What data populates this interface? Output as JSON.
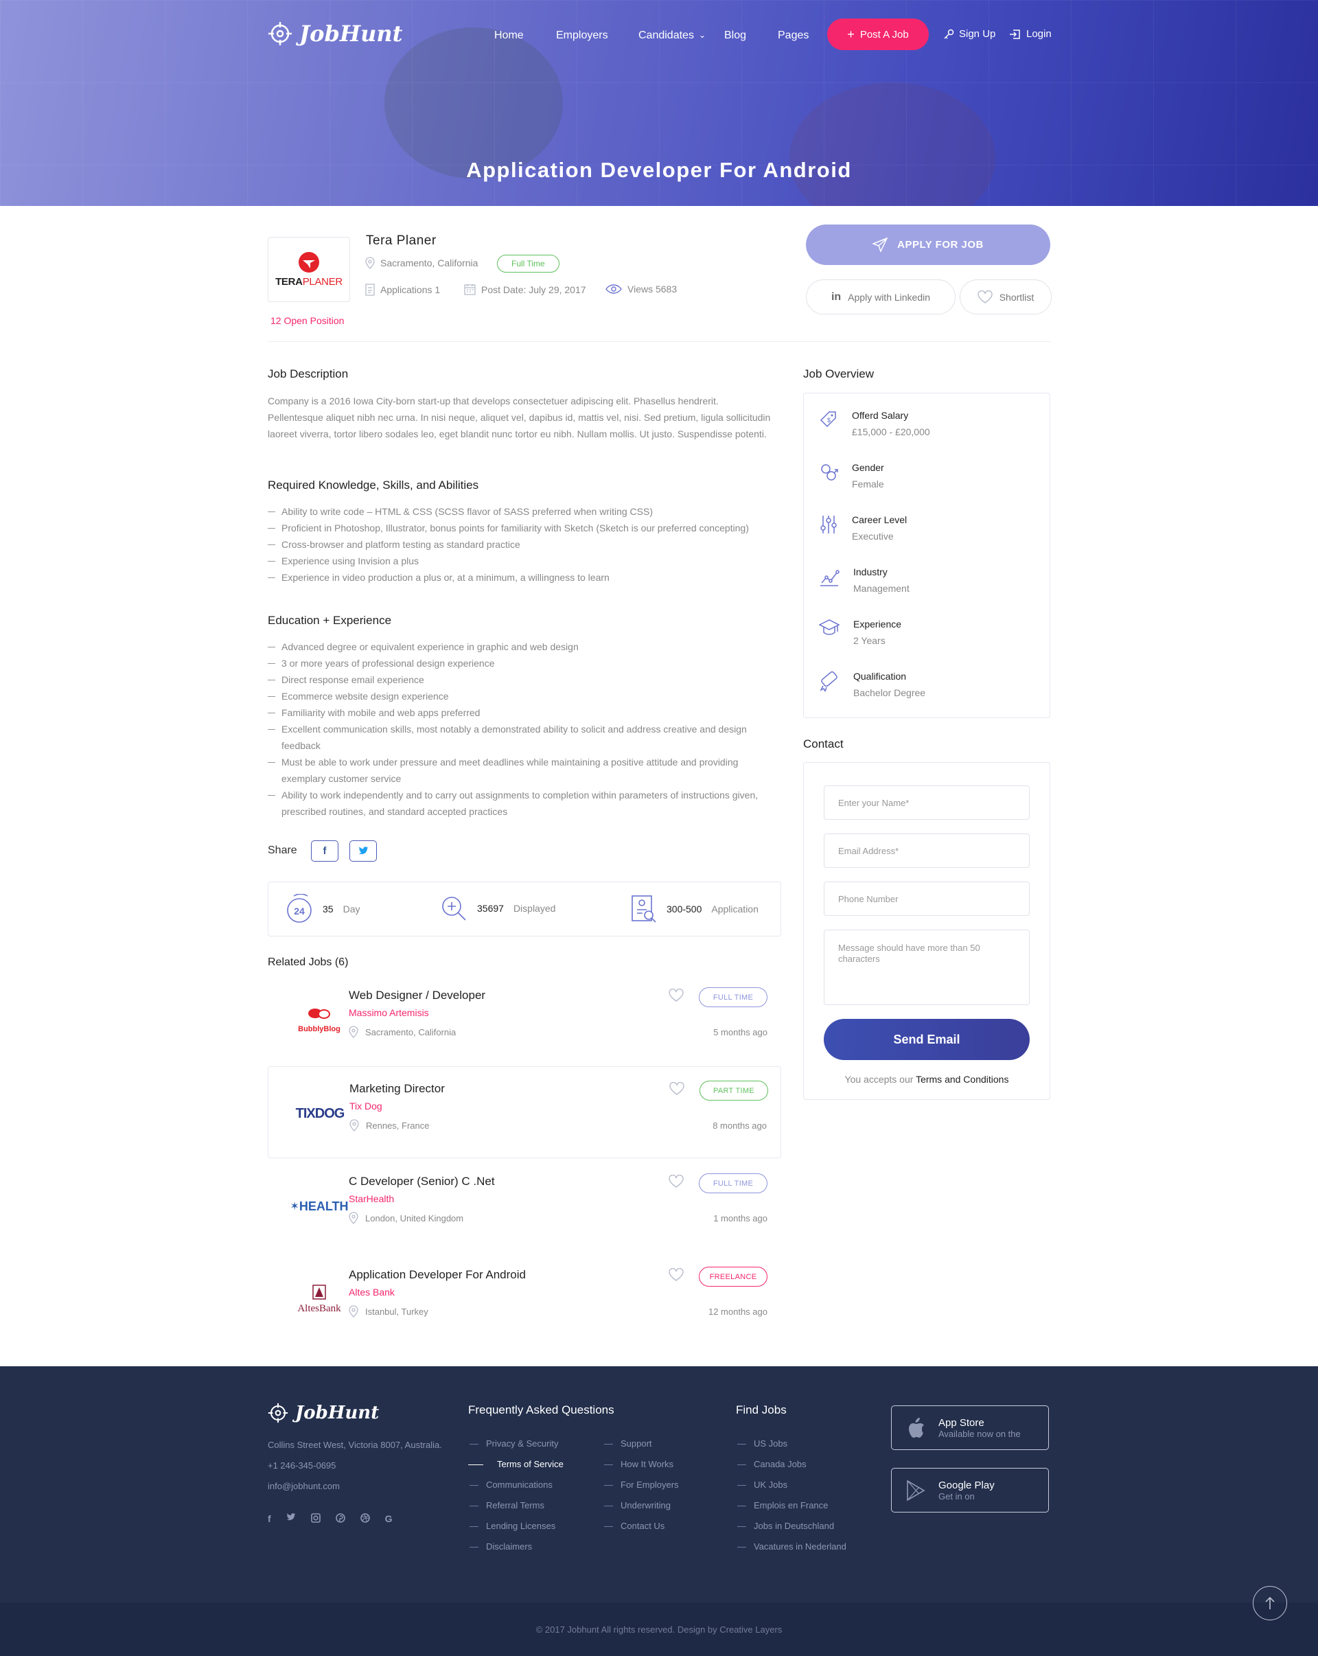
{
  "brand": {
    "name": "JobHunt"
  },
  "nav": {
    "items": [
      "Home",
      "Employers",
      "Candidates",
      "Blog",
      "Pages"
    ],
    "post_job": "Post A Job",
    "signup": "Sign Up",
    "login": "Login"
  },
  "hero": {
    "title": "Application Developer For Android"
  },
  "company": {
    "logo_text_a": "TERA",
    "logo_text_b": "PLANER",
    "name": "Tera Planer",
    "location": "Sacramento, California",
    "job_type": "Full Time",
    "applications": "Applications 1",
    "post_date": "Post Date: July 29, 2017",
    "views": "Views 5683",
    "open_positions": "12 Open Position"
  },
  "actions": {
    "apply": "APPLY FOR JOB",
    "linkedin": "Apply with Linkedin",
    "shortlist": "Shortlist"
  },
  "description": {
    "heading": "Job Description",
    "text": "Company is a 2016 Iowa City-born start-up that develops consectetuer adipiscing elit. Phasellus hendrerit. Pellentesque aliquet nibh nec urna. In nisi neque, aliquet vel, dapibus id, mattis vel, nisi. Sed pretium, ligula sollicitudin laoreet viverra, tortor libero sodales leo, eget blandit nunc tortor eu nibh. Nullam mollis. Ut justo. Suspendisse potenti."
  },
  "skills": {
    "heading": "Required Knowledge, Skills, and Abilities",
    "items": [
      "Ability to write code – HTML & CSS (SCSS flavor of SASS preferred when writing CSS)",
      "Proficient in Photoshop, Illustrator, bonus points for familiarity with Sketch (Sketch is our preferred concepting)",
      "Cross-browser and platform testing as standard practice",
      "Experience using Invision a plus",
      "Experience in video production a plus or, at a minimum, a willingness to learn"
    ]
  },
  "education": {
    "heading": "Education + Experience",
    "items": [
      "Advanced degree or equivalent experience in graphic and web design",
      "3 or more years of professional design experience",
      "Direct response email experience",
      "Ecommerce website design experience",
      "Familiarity with mobile and web apps preferred",
      "Excellent communication skills, most notably a demonstrated ability to solicit and address creative and design feedback",
      "Must be able to work under pressure and meet deadlines while maintaining a positive attitude and providing exemplary customer service",
      "Ability to work independently and to carry out assignments to completion within parameters of instructions given, prescribed routines, and standard accepted practices"
    ]
  },
  "share": {
    "label": "Share",
    "facebook": "f",
    "twitter": "t"
  },
  "stats": [
    {
      "icon_num": "24",
      "value": "35",
      "label": "Day"
    },
    {
      "value": "35697",
      "label": "Displayed"
    },
    {
      "value": "300-500",
      "label": "Application"
    }
  ],
  "related": {
    "heading": "Related Jobs (6)",
    "jobs": [
      {
        "logo": "BubblyBlog",
        "title": "Web Designer / Developer",
        "company": "Massimo Artemisis",
        "location": "Sacramento, California",
        "type": "FULL TIME",
        "ago": "5 months ago"
      },
      {
        "logo": "TIXDOG",
        "title": "Marketing Director",
        "company": "Tix Dog",
        "location": "Rennes, France",
        "type": "PART TIME",
        "ago": "8 months ago"
      },
      {
        "logo": "HEALTH",
        "title": "C Developer (Senior) C .Net",
        "company": "StarHealth",
        "location": "London, United Kingdom",
        "type": "FULL TIME",
        "ago": "1 months ago"
      },
      {
        "logo": "AltesBank",
        "title": "Application Developer For Android",
        "company": "Altes Bank",
        "location": "Istanbul, Turkey",
        "type": "FREELANCE",
        "ago": "12 months ago"
      }
    ]
  },
  "overview": {
    "heading": "Job Overview",
    "items": [
      {
        "label": "Offerd Salary",
        "value": "£15,000 - £20,000",
        "icon": "money-tag-icon"
      },
      {
        "label": "Gender",
        "value": "Female",
        "icon": "gender-icon"
      },
      {
        "label": "Career Level",
        "value": "Executive",
        "icon": "sliders-icon"
      },
      {
        "label": "Industry",
        "value": "Management",
        "icon": "chart-icon"
      },
      {
        "label": "Experience",
        "value": "2 Years",
        "icon": "graduation-cap-icon"
      },
      {
        "label": "Qualification",
        "value": "Bachelor Degree",
        "icon": "diploma-icon"
      }
    ]
  },
  "contact": {
    "heading": "Contact",
    "name_placeholder": "Enter your Name*",
    "email_placeholder": "Email Address*",
    "phone_placeholder": "Phone Number",
    "message_placeholder": "Message should have more than 50 characters",
    "send": "Send Email",
    "terms_prefix": "You accepts our",
    "terms_link": "Terms and Conditions"
  },
  "footer": {
    "address": "Collins Street West, Victoria 8007, Australia.",
    "phone": "+1 246-345-0695",
    "email": "info@jobhunt.com",
    "faq_heading": "Frequently Asked Questions",
    "faq_col1": [
      "Privacy & Security",
      "Terms of Service",
      "Communications",
      "Referral Terms",
      "Lending Licenses",
      "Disclaimers"
    ],
    "faq_col2": [
      "Support",
      "How It Works",
      "For Employers",
      "Underwriting",
      "Contact Us"
    ],
    "find_heading": "Find Jobs",
    "find_items": [
      "US Jobs",
      "Canada Jobs",
      "UK Jobs",
      "Emplois en France",
      "Jobs in Deutschland",
      "Vacatures in Nederland"
    ],
    "appstore_title": "App Store",
    "appstore_sub": "Available now on the",
    "gplay_title": "Google Play",
    "gplay_sub": "Get in on",
    "copyright": "© 2017 Jobhunt All rights reserved. Design by Creative Layers"
  },
  "colors": {
    "accent": "#f5266c",
    "primary": "#4b59b8",
    "hero_start": "#8f93da",
    "hero_end": "#2b309e",
    "footer": "#232f4b"
  }
}
